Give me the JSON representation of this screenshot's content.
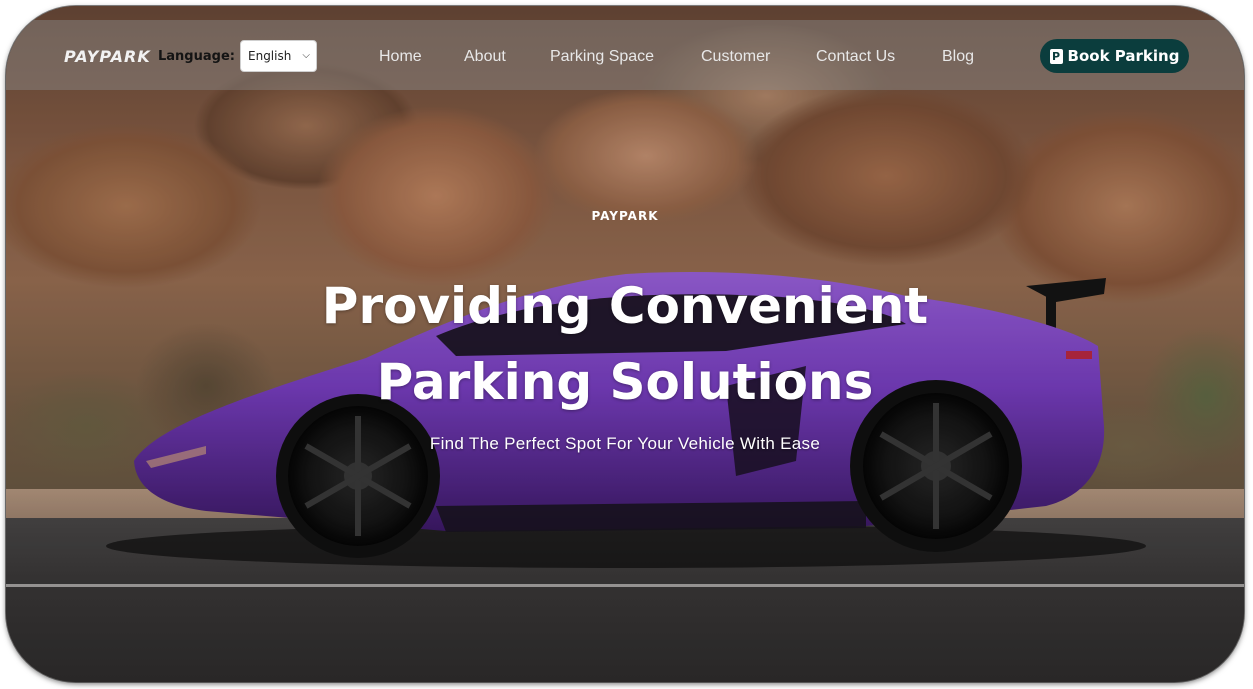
{
  "navbar": {
    "brand": "PAYPARK",
    "language_label": "Language:",
    "language_selected": "English",
    "items": [
      "Home",
      "About",
      "Parking Space",
      "Customer",
      "Contact Us",
      "Blog"
    ],
    "cta_label": "Book Parking",
    "cta_icon": "parking-icon",
    "cta_color": "#0b3d3d"
  },
  "hero": {
    "eyebrow": "PAYPARK",
    "title_line1": "Providing Convenient",
    "title_line2": "Parking Solutions",
    "subtitle": "Find The Perfect Spot For Your Vehicle With Ease"
  },
  "colors": {
    "car_body": "#7a3fc4",
    "text": "#ffffff"
  }
}
